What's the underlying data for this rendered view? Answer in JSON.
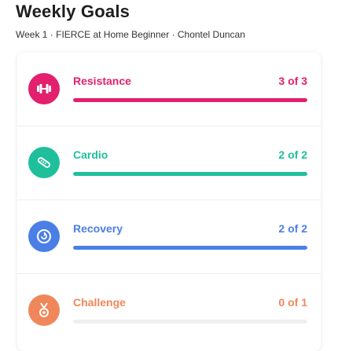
{
  "header": {
    "title": "Weekly Goals",
    "subtitle": "Week 1 · FIERCE at Home Beginner · Chontel Duncan"
  },
  "goals": [
    {
      "label": "Resistance",
      "count": "3 of 3",
      "progress": 1.0,
      "color": "#e2206e",
      "icon": "dumbbell-icon"
    },
    {
      "label": "Cardio",
      "count": "2 of 2",
      "progress": 1.0,
      "color": "#1fbf9c",
      "icon": "sneaker-icon"
    },
    {
      "label": "Recovery",
      "count": "2 of 2",
      "progress": 1.0,
      "color": "#4b7fe6",
      "icon": "recovery-icon"
    },
    {
      "label": "Challenge",
      "count": "0 of 1",
      "progress": 0.0,
      "color": "#f0875a",
      "icon": "medal-icon"
    }
  ]
}
